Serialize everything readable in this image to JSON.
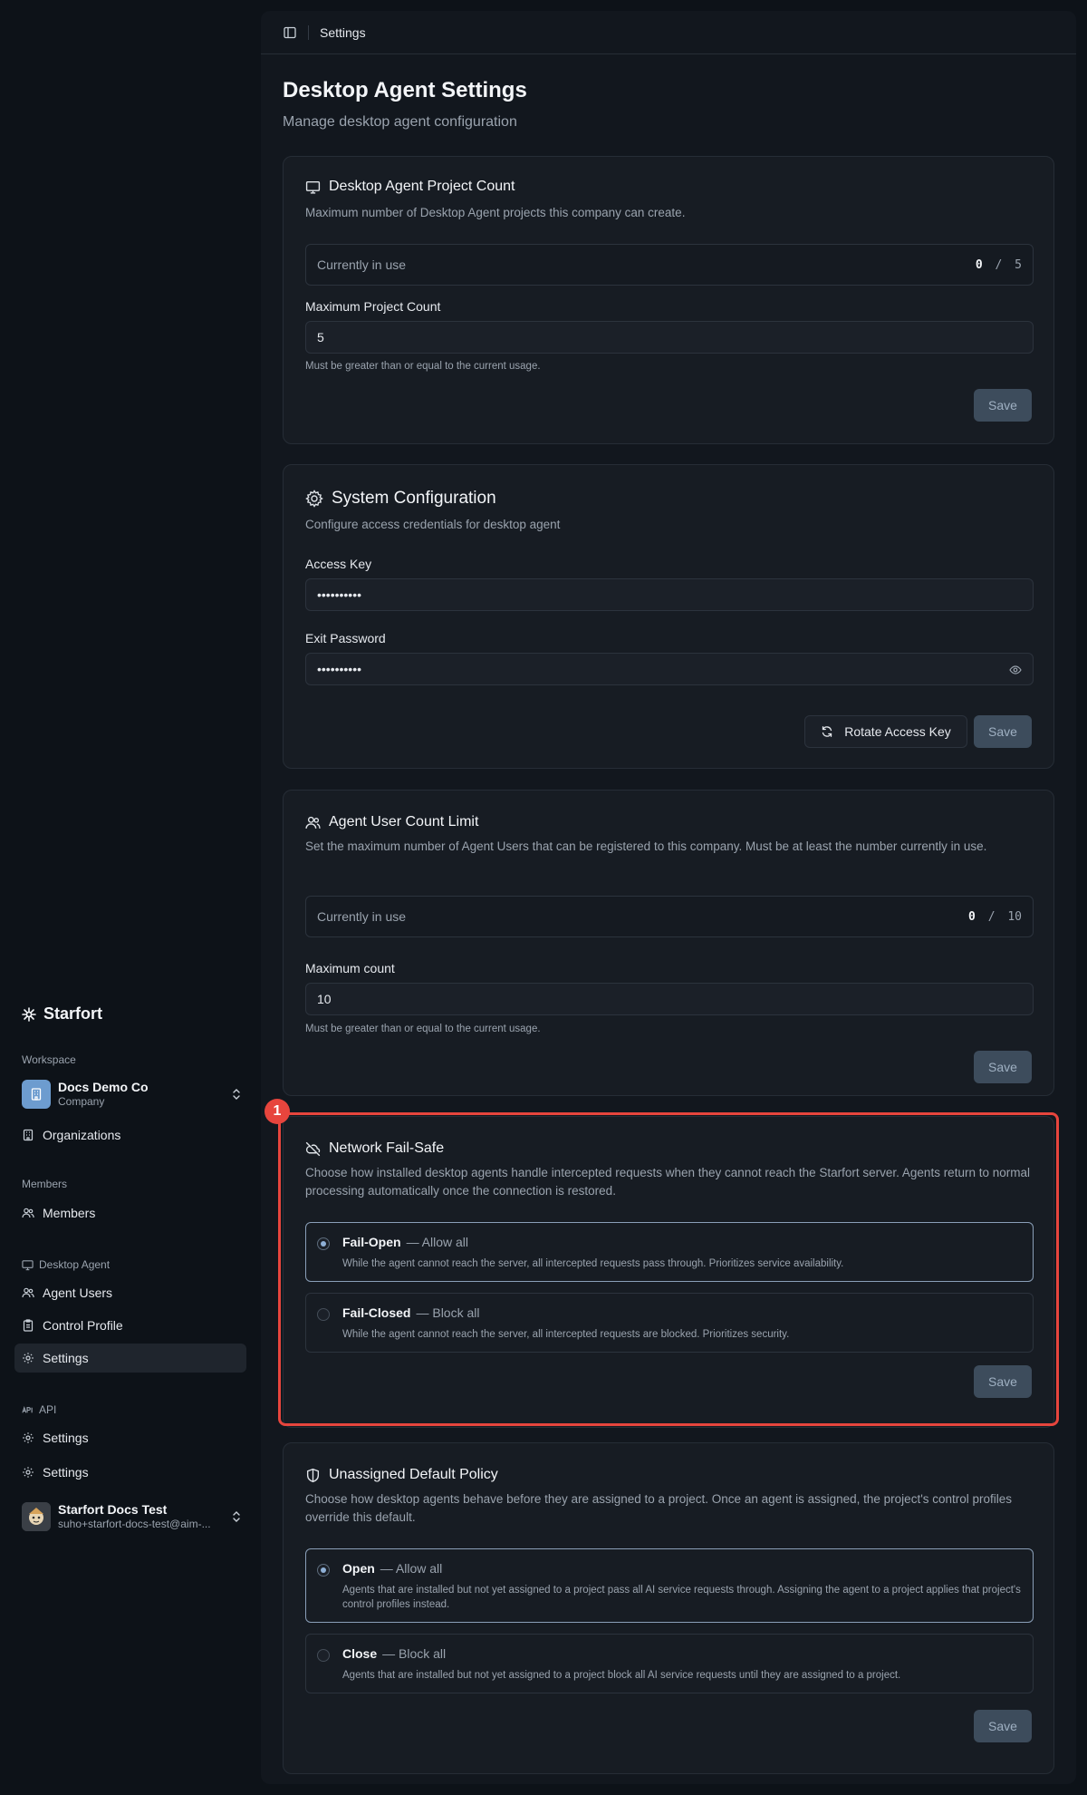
{
  "sidebar": {
    "brand": "Starfort",
    "workspace_label": "Workspace",
    "workspace_name": "Docs Demo Co",
    "workspace_type": "Company",
    "organizations": "Organizations",
    "members_label": "Members",
    "members": "Members",
    "desktop_agent_label": "Desktop Agent",
    "agent_users": "Agent Users",
    "control_profile": "Control Profile",
    "settings": "Settings",
    "api_label": "API",
    "api_settings": "Settings",
    "settings2": "Settings",
    "user_name": "Starfort Docs Test",
    "user_email": "suho+starfort-docs-test@aim-..."
  },
  "topbar": {
    "breadcrumb": "Settings"
  },
  "page": {
    "title": "Desktop Agent Settings",
    "subtitle": "Manage desktop agent configuration"
  },
  "project_count": {
    "title": "Desktop Agent Project Count",
    "description": "Maximum number of Desktop Agent projects this company can create.",
    "usage_label": "Currently in use",
    "usage_current": "0",
    "usage_sep": "/",
    "usage_max": "5",
    "field_label": "Maximum Project Count",
    "field_value": "5",
    "hint": "Must be greater than or equal to the current usage.",
    "save": "Save"
  },
  "system_config": {
    "title": "System Configuration",
    "description": "Configure access credentials for desktop agent",
    "access_key_label": "Access Key",
    "access_key_value": "••••••••••",
    "exit_password_label": "Exit Password",
    "exit_password_value": "••••••••••",
    "rotate": "Rotate Access Key",
    "save": "Save"
  },
  "agent_user_limit": {
    "title": "Agent User Count Limit",
    "description": "Set the maximum number of Agent Users that can be registered to this company. Must be at least the number currently in use.",
    "usage_label": "Currently in use",
    "usage_current": "0",
    "usage_sep": "/",
    "usage_max": "10",
    "field_label": "Maximum count",
    "field_value": "10",
    "hint": "Must be greater than or equal to the current usage.",
    "save": "Save"
  },
  "fail_safe": {
    "badge": "1",
    "title": "Network Fail-Safe",
    "description": "Choose how installed desktop agents handle intercepted requests when they cannot reach the Starfort server. Agents return to normal processing automatically once the connection is restored.",
    "options": [
      {
        "name": "Fail-Open",
        "suffix": "— Allow all",
        "desc": "While the agent cannot reach the server, all intercepted requests pass through. Prioritizes service availability."
      },
      {
        "name": "Fail-Closed",
        "suffix": "— Block all",
        "desc": "While the agent cannot reach the server, all intercepted requests are blocked. Prioritizes security."
      }
    ],
    "save": "Save"
  },
  "default_policy": {
    "title": "Unassigned Default Policy",
    "description": "Choose how desktop agents behave before they are assigned to a project. Once an agent is assigned, the project's control profiles override this default.",
    "options": [
      {
        "name": "Open",
        "suffix": "— Allow all",
        "desc": "Agents that are installed but not yet assigned to a project pass all AI service requests through. Assigning the agent to a project applies that project's control profiles instead."
      },
      {
        "name": "Close",
        "suffix": "— Block all",
        "desc": "Agents that are installed but not yet assigned to a project block all AI service requests until they are assigned to a project."
      }
    ],
    "save": "Save"
  }
}
